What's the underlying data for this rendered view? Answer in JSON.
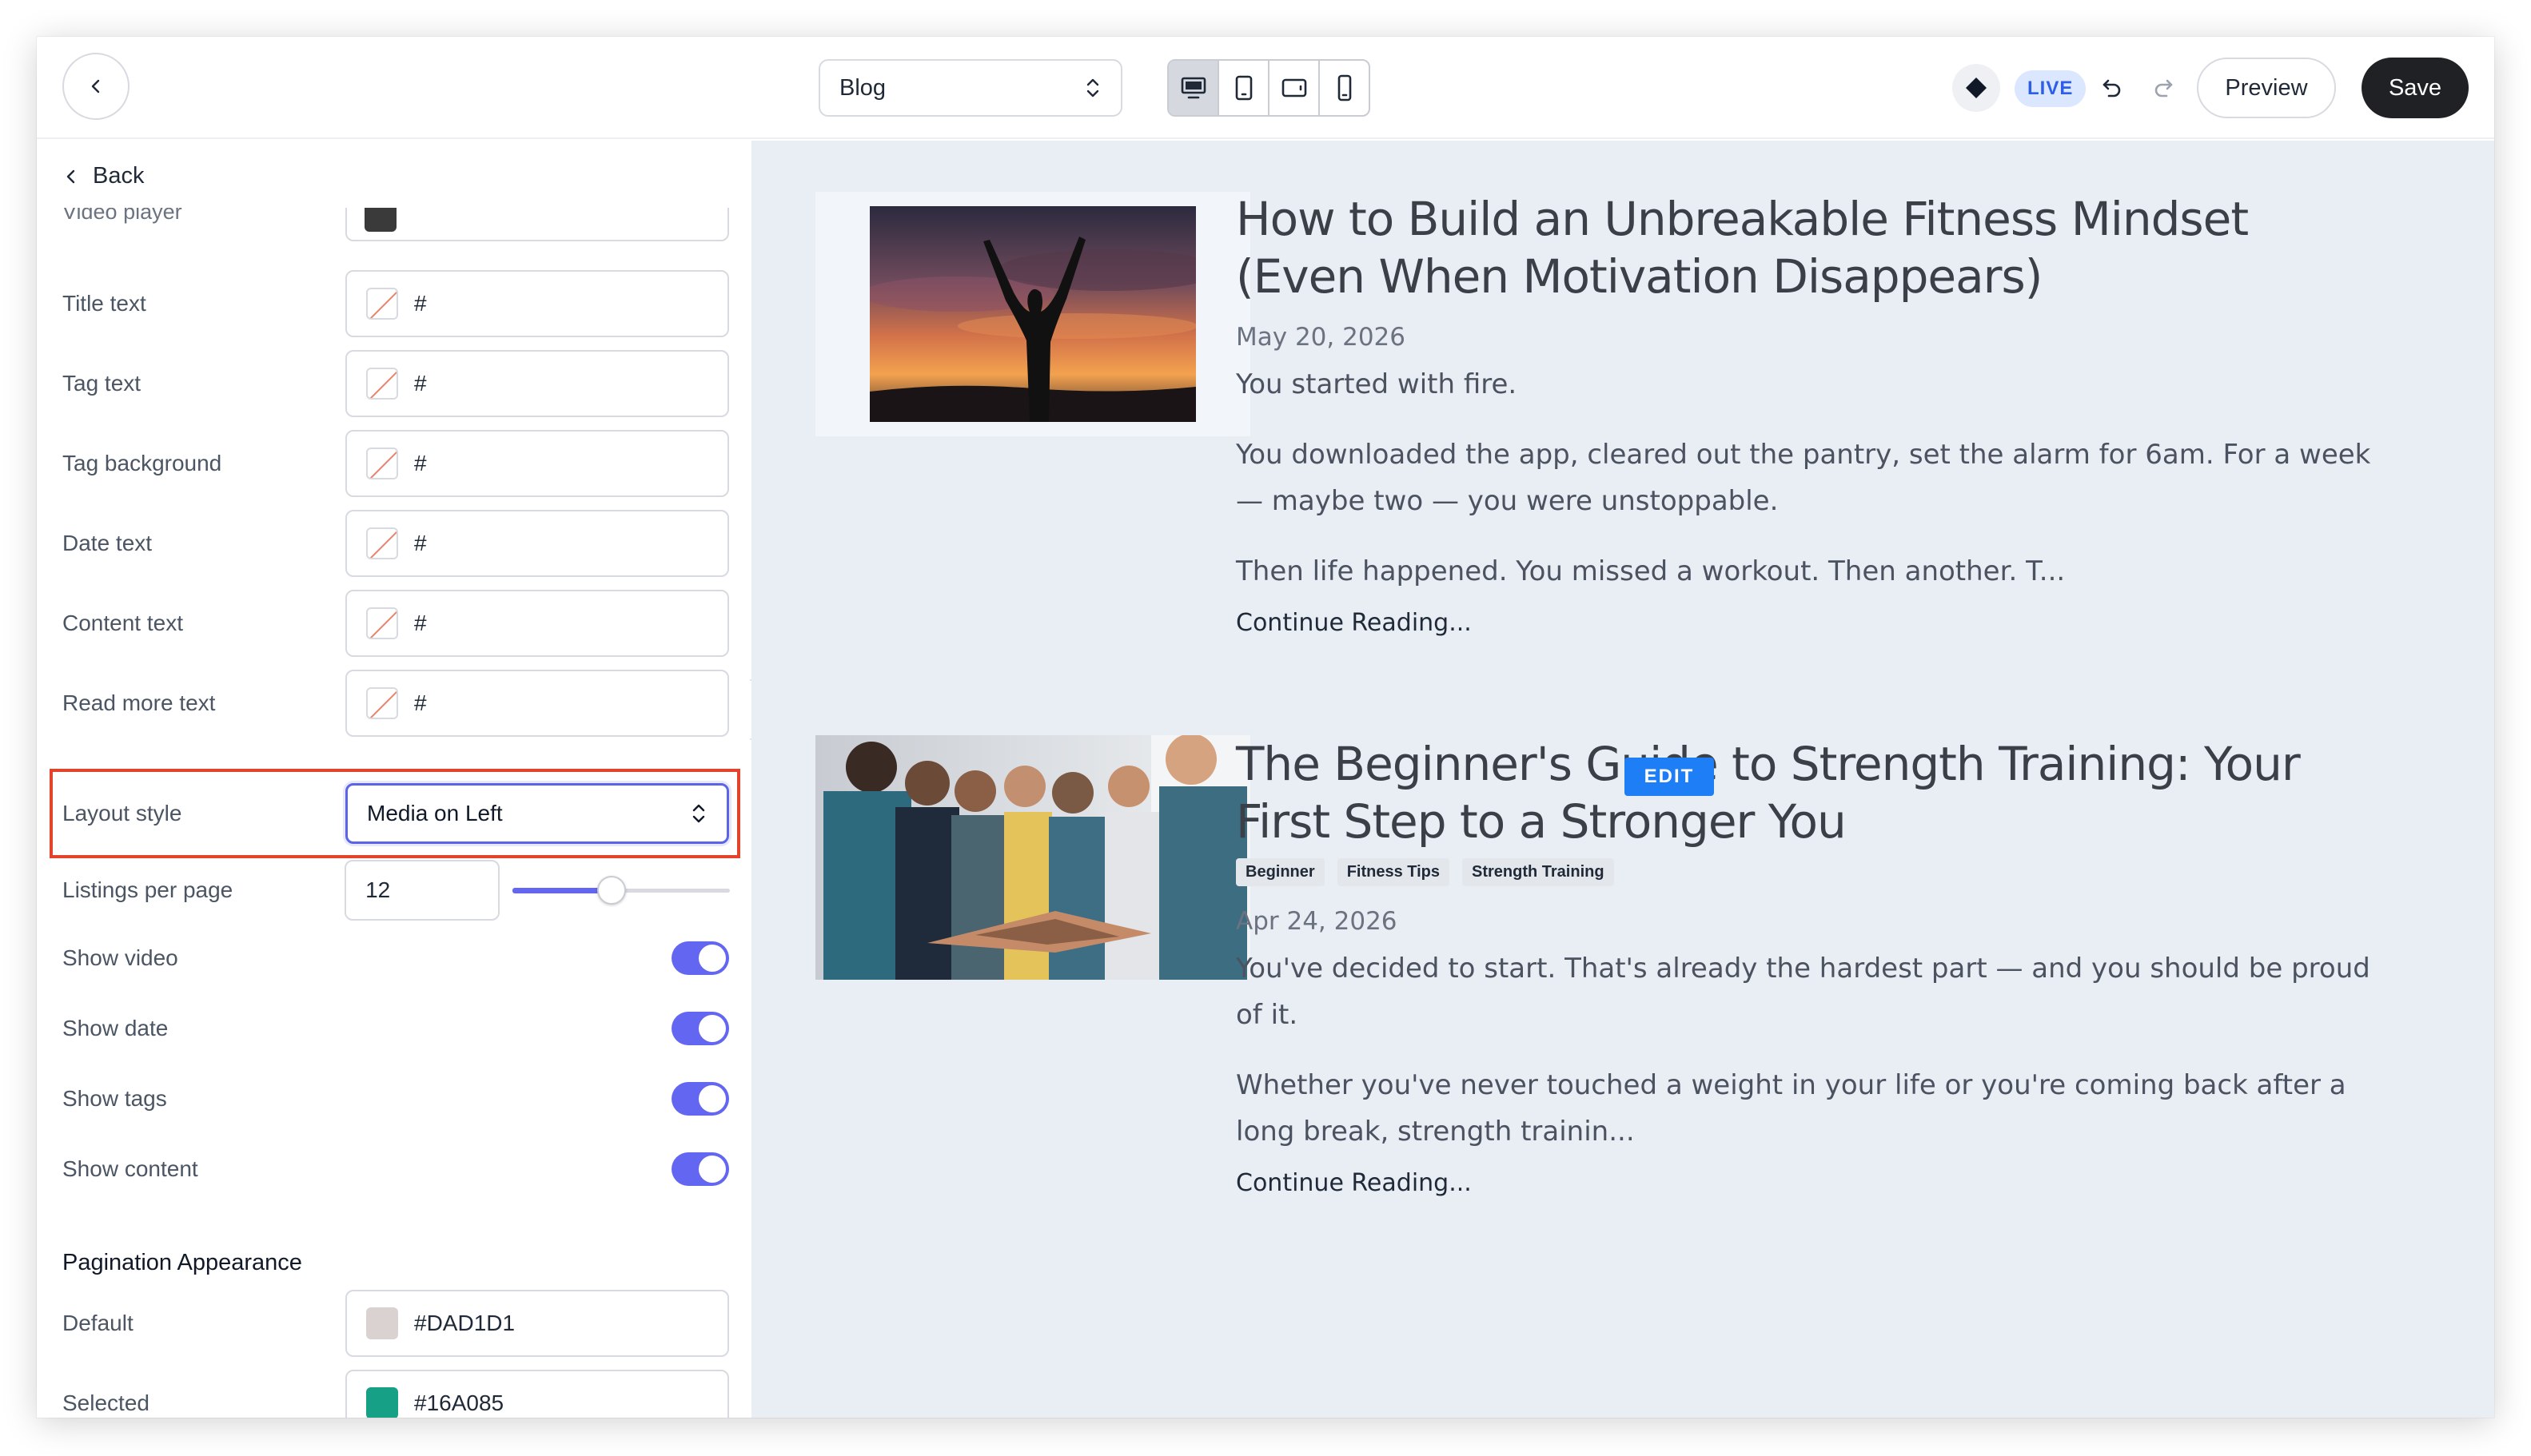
{
  "topbar": {
    "page_select_value": "Blog",
    "live_label": "LIVE",
    "preview_label": "Preview",
    "save_label": "Save"
  },
  "sidebar": {
    "back_label": "Back",
    "partial_row": {
      "label": "Video player",
      "value": ""
    },
    "color_fields": [
      {
        "label": "Title text",
        "value": "#"
      },
      {
        "label": "Tag text",
        "value": "#"
      },
      {
        "label": "Tag background",
        "value": "#"
      },
      {
        "label": "Date text",
        "value": "#"
      },
      {
        "label": "Content text",
        "value": "#"
      },
      {
        "label": "Read more text",
        "value": "#"
      }
    ],
    "layout_style": {
      "label": "Layout style",
      "value": "Media on Left"
    },
    "listings_per_page": {
      "label": "Listings per page",
      "value": "12",
      "slider_fraction": 0.45
    },
    "toggles": [
      {
        "label": "Show video",
        "on": true
      },
      {
        "label": "Show date",
        "on": true
      },
      {
        "label": "Show tags",
        "on": true
      },
      {
        "label": "Show content",
        "on": true
      }
    ],
    "pagination": {
      "heading": "Pagination Appearance",
      "default": {
        "label": "Default",
        "value": "#DAD1D1",
        "color": "#DAD1D1"
      },
      "selected": {
        "label": "Selected",
        "value": "#16A085",
        "color": "#16A085"
      }
    }
  },
  "posts": [
    {
      "title": "How to Build an Unbreakable Fitness Mindset (Even When Motivation Disappears)",
      "date": "May 20, 2026",
      "tags": [],
      "paragraphs": [
        "You started with fire.",
        "You downloaded the app, cleared out the pantry, set the alarm for 6am. For a week — maybe two — you were unstoppable.",
        "Then life happened. You missed a workout. Then another. T..."
      ],
      "read_more": "Continue Reading..."
    },
    {
      "title": "The Beginner's Guide to Strength Training: Your First Step to a Stronger You",
      "date": "Apr 24, 2026",
      "tags": [
        "Beginner",
        "Fitness Tips",
        "Strength Training"
      ],
      "paragraphs": [
        "You've decided to start. That's already the hardest part — and you should be proud of it.",
        "Whether you've never touched a weight in your life or you're coming back after a long break, strength trainin..."
      ],
      "read_more": "Continue Reading..."
    }
  ],
  "edit_badge": "EDIT",
  "colors": {
    "accent": "#6366f1",
    "highlight_border": "#e2432a",
    "live_badge_text": "#2c5ee8",
    "edit_badge": "#1e7ef5",
    "canvas_bg": "#e9edf4"
  }
}
